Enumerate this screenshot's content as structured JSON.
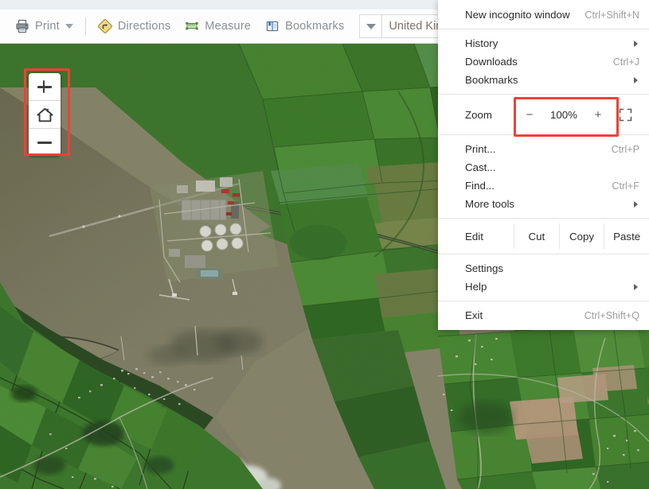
{
  "toolbar": {
    "items": [
      {
        "id": "print",
        "label": "Print",
        "icon": "printer-icon",
        "has_caret": true
      },
      {
        "id": "directions",
        "label": "Directions",
        "icon": "directions-sign-icon",
        "has_caret": false
      },
      {
        "id": "measure",
        "label": "Measure",
        "icon": "ruler-icon",
        "has_caret": false
      },
      {
        "id": "bookmarks",
        "label": "Bookmarks",
        "icon": "book-icon",
        "has_caret": false
      }
    ],
    "country_selector": {
      "value": "United Kingdom",
      "dropdown_icon": "triangle-down-icon"
    }
  },
  "map_controls": {
    "zoom_in_label": "+",
    "home_label": "home-icon",
    "zoom_out_label": "−",
    "highlight_color": "#ef4136"
  },
  "menu": {
    "groups": [
      {
        "id": "group-incognito",
        "rows": [
          {
            "id": "new-incognito-window",
            "label": "New incognito window",
            "accel": "Ctrl+Shift+N",
            "submenu": false
          }
        ]
      },
      {
        "id": "group-browse",
        "rows": [
          {
            "id": "history",
            "label": "History",
            "accel": "",
            "submenu": true
          },
          {
            "id": "downloads",
            "label": "Downloads",
            "accel": "Ctrl+J",
            "submenu": false
          },
          {
            "id": "bookmarks",
            "label": "Bookmarks",
            "accel": "",
            "submenu": true
          }
        ]
      },
      {
        "id": "group-zoom",
        "zoom": {
          "label": "Zoom",
          "minus": "−",
          "value": "100%",
          "plus": "+",
          "fullscreen_icon": "fullscreen-icon"
        }
      },
      {
        "id": "group-tools",
        "rows": [
          {
            "id": "print",
            "label": "Print...",
            "accel": "Ctrl+P",
            "submenu": false
          },
          {
            "id": "cast",
            "label": "Cast...",
            "accel": "",
            "submenu": false
          },
          {
            "id": "find",
            "label": "Find...",
            "accel": "Ctrl+F",
            "submenu": false
          },
          {
            "id": "more-tools",
            "label": "More tools",
            "accel": "",
            "submenu": true
          }
        ]
      },
      {
        "id": "group-edit",
        "edit_row": {
          "label": "Edit",
          "cut": "Cut",
          "copy": "Copy",
          "paste": "Paste"
        }
      },
      {
        "id": "group-settings",
        "rows": [
          {
            "id": "settings",
            "label": "Settings",
            "accel": "",
            "submenu": false
          },
          {
            "id": "help",
            "label": "Help",
            "accel": "",
            "submenu": true
          }
        ]
      },
      {
        "id": "group-exit",
        "rows": [
          {
            "id": "exit",
            "label": "Exit",
            "accel": "Ctrl+Shift+Q",
            "submenu": false
          }
        ]
      }
    ]
  },
  "map": {
    "description": "satellite-aerial-imagery-estuary",
    "colors": {
      "water": "#7d7a5e",
      "field_green": "#4e8b36",
      "field_dark": "#2f5c24",
      "field_pink": "#c6a79b",
      "industrial": "#b8b7ad"
    }
  }
}
